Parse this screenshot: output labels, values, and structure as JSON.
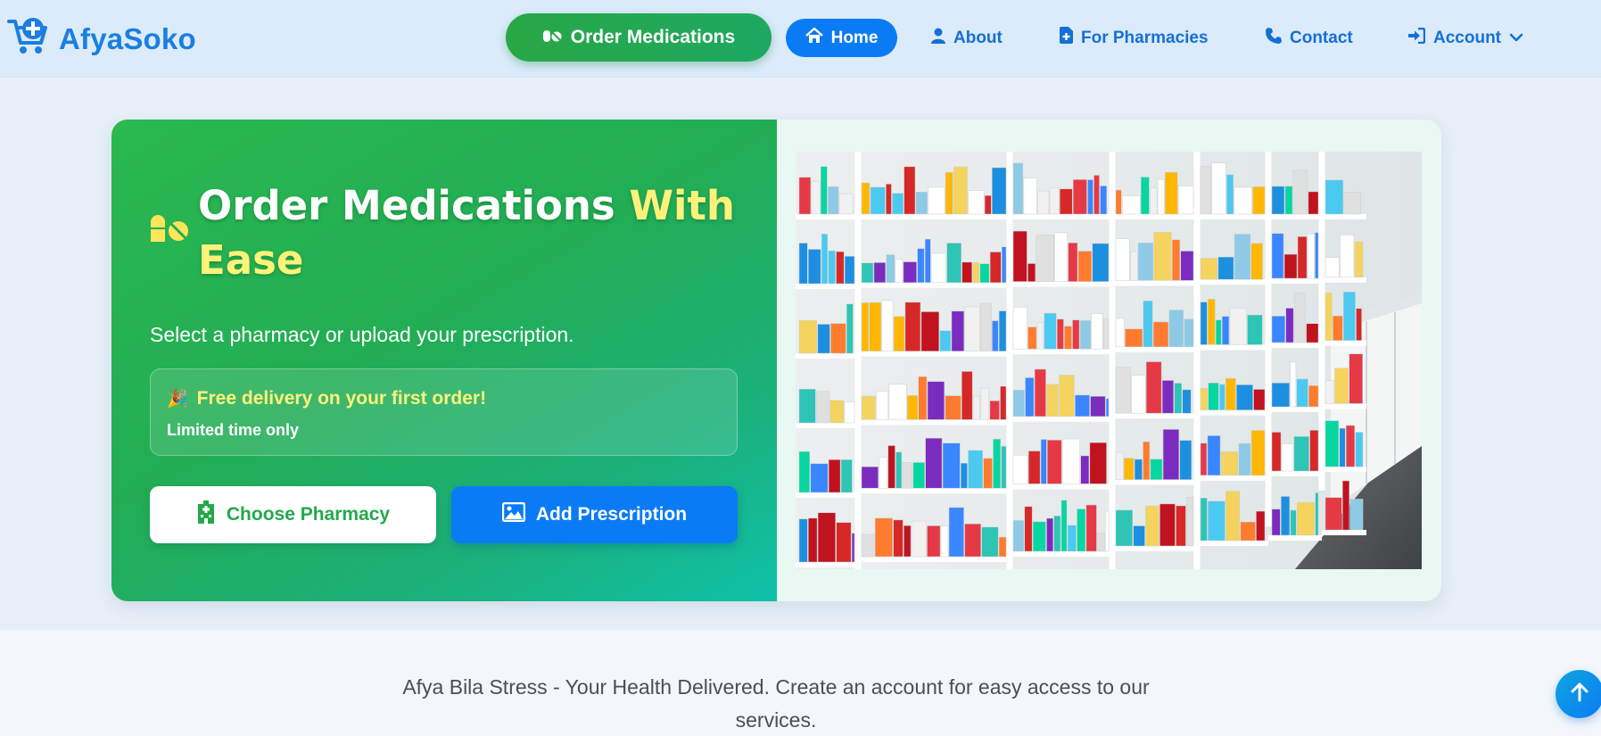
{
  "brand": {
    "name": "AfyaSoko",
    "icon": "cart-plus-icon"
  },
  "nav": {
    "order_label": "Order Medications",
    "home_label": "Home",
    "about_label": "About",
    "pharmacies_label": "For Pharmacies",
    "contact_label": "Contact",
    "account_label": "Account"
  },
  "hero": {
    "title_main": "Order Medications ",
    "title_accent": "With Ease",
    "subtitle": "Select a pharmacy or upload your prescription.",
    "promo_emoji": "🎉",
    "promo_title": "Free delivery on your first order!",
    "promo_sub": "Limited time only",
    "choose_label": "Choose Pharmacy",
    "add_label": "Add Prescription"
  },
  "footer": {
    "tagline": "Afya Bila Stress - Your Health Delivered. Create an account for easy access to our services."
  },
  "colors": {
    "primary_blue": "#0b7bf5",
    "brand_green": "#28a745",
    "accent_yellow": "#fff27a"
  }
}
